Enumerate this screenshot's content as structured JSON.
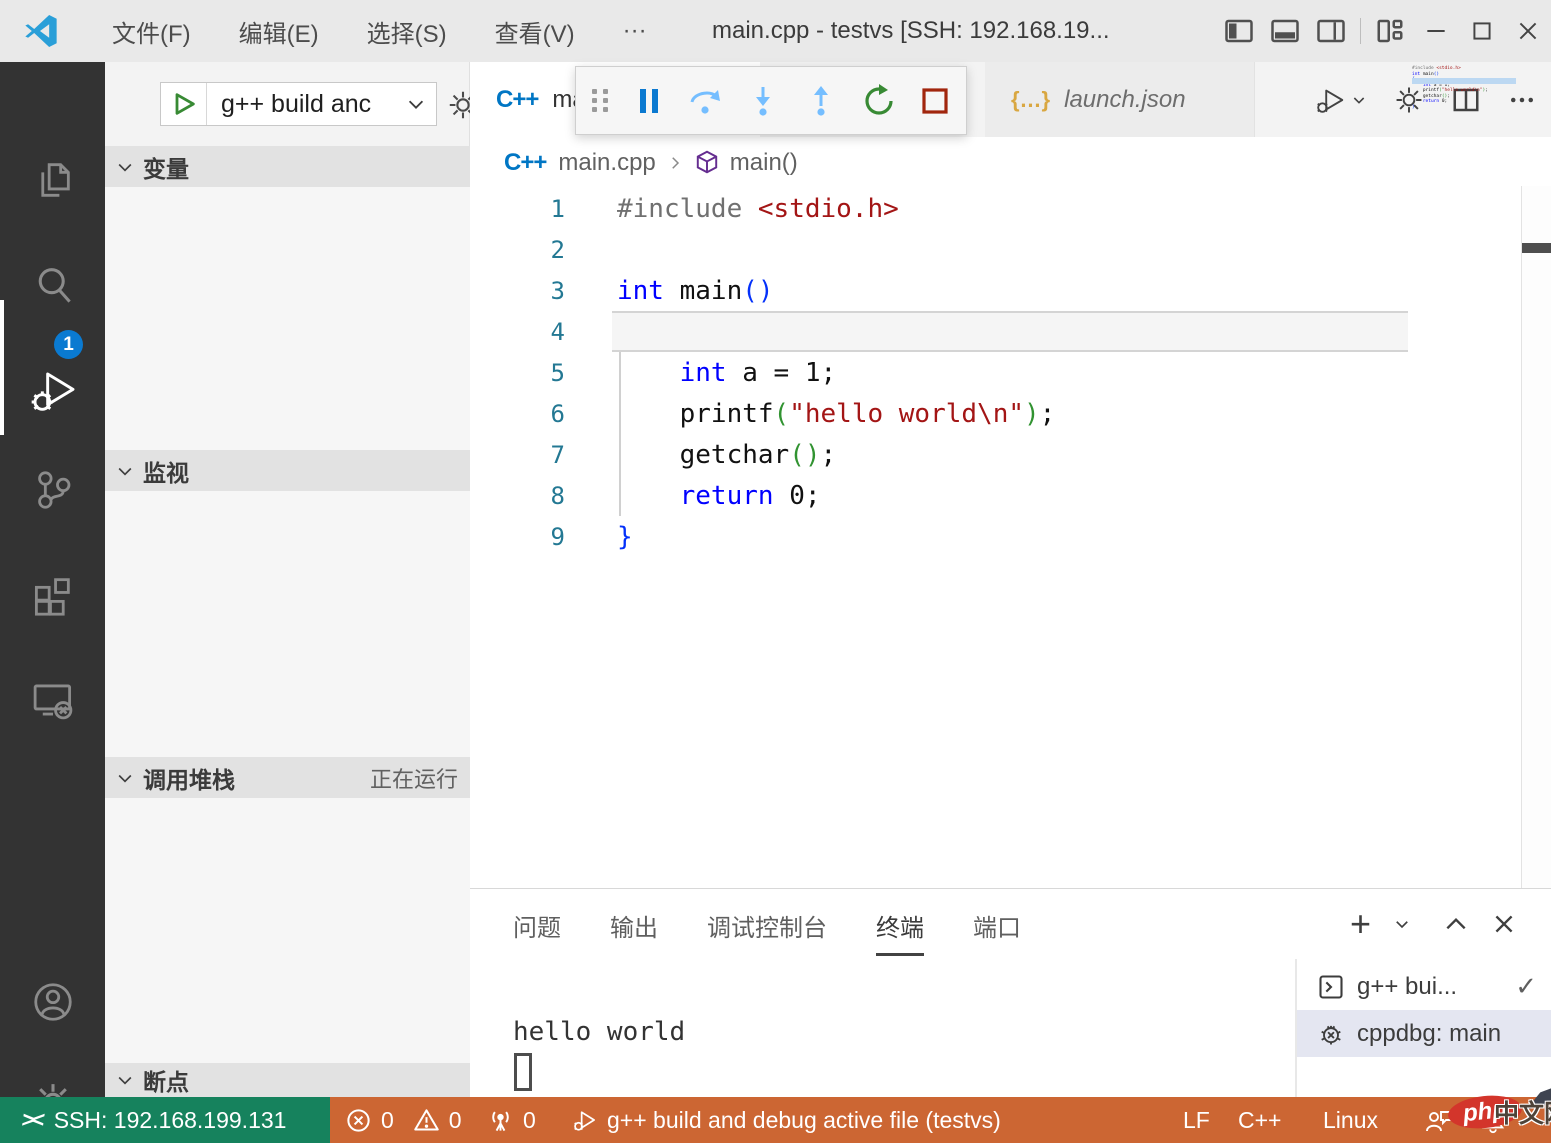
{
  "titlebar": {
    "menus": [
      "文件(F)",
      "编辑(E)",
      "选择(S)",
      "查看(V)",
      "···"
    ],
    "title": "main.cpp - testvs [SSH: 192.168.19..."
  },
  "activity_bar": {
    "debug_badge": "1"
  },
  "sidebar": {
    "run_config": "g++ build anc",
    "sections": {
      "variables": "变量",
      "watch": "监视",
      "call_stack": "调用堆栈",
      "call_stack_status": "正在运行",
      "breakpoints": "断点"
    }
  },
  "editor": {
    "tabs": [
      {
        "label": "main.cpp"
      },
      {
        "label": "launch.json"
      }
    ],
    "breadcrumb": {
      "file": "main.cpp",
      "symbol": "main()"
    },
    "code": {
      "lines": [
        {
          "s": [
            {
              "t": "#include ",
              "c": "pp"
            },
            {
              "t": "<stdio.h>",
              "c": "s"
            }
          ]
        },
        {
          "s": []
        },
        {
          "s": [
            {
              "t": "int",
              "c": "k"
            },
            {
              "t": " main",
              "c": "fg"
            },
            {
              "t": "()",
              "c": "b1"
            }
          ]
        },
        {
          "highlight": true,
          "s": [
            {
              "t": "{",
              "c": "b1"
            }
          ]
        },
        {
          "s": [
            {
              "t": "    ",
              "c": "fg"
            },
            {
              "t": "int",
              "c": "k"
            },
            {
              "t": " a = 1;",
              "c": "fg"
            }
          ]
        },
        {
          "s": [
            {
              "t": "    printf",
              "c": "fg"
            },
            {
              "t": "(",
              "c": "b2"
            },
            {
              "t": "\"hello world\\n\"",
              "c": "s"
            },
            {
              "t": ")",
              "c": "b2"
            },
            {
              "t": ";",
              "c": "fg"
            }
          ]
        },
        {
          "s": [
            {
              "t": "    getchar",
              "c": "fg"
            },
            {
              "t": "()",
              "c": "b2"
            },
            {
              "t": ";",
              "c": "fg"
            }
          ]
        },
        {
          "s": [
            {
              "t": "    ",
              "c": "fg"
            },
            {
              "t": "return",
              "c": "k"
            },
            {
              "t": " 0;",
              "c": "fg"
            }
          ]
        },
        {
          "s": [
            {
              "t": "}",
              "c": "b1"
            }
          ]
        }
      ]
    }
  },
  "panel": {
    "tabs": [
      "问题",
      "输出",
      "调试控制台",
      "终端",
      "端口"
    ],
    "active_tab": "终端",
    "terminal_output": "hello world",
    "terminals": [
      {
        "label": "g++ bui...",
        "icon": "terminal",
        "checked": true,
        "selected": false
      },
      {
        "label": "cppdbg: main",
        "icon": "debug",
        "checked": false,
        "selected": true
      }
    ]
  },
  "statusbar": {
    "remote": "SSH: 192.168.199.131",
    "errors": "0",
    "warnings": "0",
    "ports": "0",
    "debug_config": "g++ build and debug active file (testvs)",
    "eol": "LF",
    "language": "C++",
    "os": "Linux"
  },
  "watermark": {
    "logo": "php",
    "text": "中文网"
  },
  "colors": {
    "statusbar_debugging": "#cc6633",
    "statusbar_remote": "#16825d",
    "badge_blue": "#0a7ad1",
    "activitybar_bg": "#333333",
    "keyword_blue": "#0000ff",
    "string_red": "#a31515",
    "bracket_green": "#319331"
  }
}
